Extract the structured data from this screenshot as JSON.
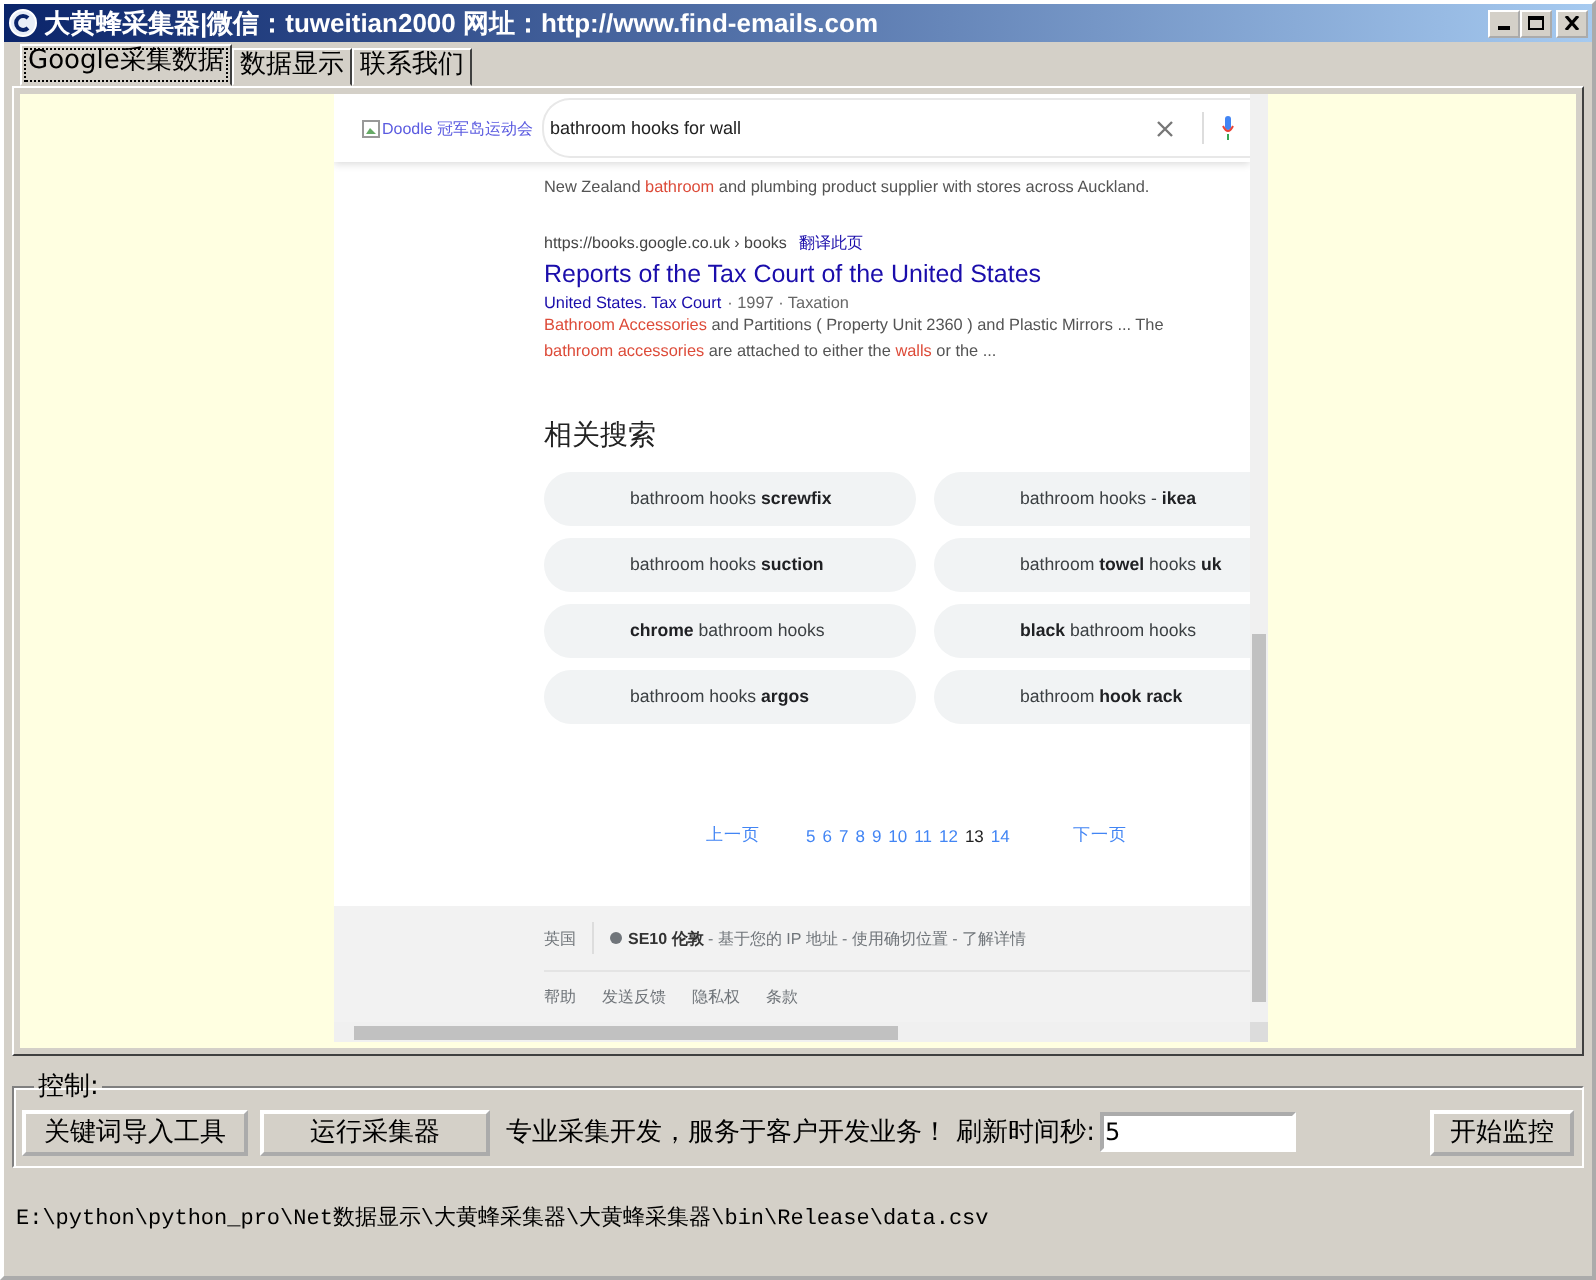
{
  "window": {
    "title": "大黄蜂采集器|微信：tuweitian2000 网址：http://www.find-emails.com"
  },
  "tabs": [
    {
      "label": "Google采集数据",
      "selected": true
    },
    {
      "label": "数据显示",
      "selected": false
    },
    {
      "label": "联系我们",
      "selected": false
    }
  ],
  "browser": {
    "doodle": "Doodle 冠军岛运动会",
    "search": {
      "value": "bathroom hooks for wall"
    },
    "results": [
      {
        "snippet": "New Zealand **bathroom** and plumbing product supplier with stores across Auckland."
      },
      {
        "url": "https://books.google.co.uk › books",
        "translate": "翻译此页",
        "title": "Reports of the Tax Court of the United States",
        "author": "United States. Tax Court",
        "meta": "· 1997 · Taxation",
        "snippet": "**Bathroom Accessories** and Partitions ( Property Unit 2360 ) and Plastic Mirrors ... The **bathroom accessories** are attached to either the **walls** or the ..."
      }
    ],
    "related_title": "相关搜索",
    "related": [
      "bathroom hooks **screwfix**",
      "bathroom hooks - **ikea**",
      "bathroom hooks **suction**",
      "bathroom **towel** hooks **uk**",
      "**chrome** bathroom hooks",
      "**black** bathroom hooks",
      "bathroom hooks **argos**",
      "bathroom **hook rack**"
    ],
    "pagination": {
      "previous": "上一页",
      "next": "下一页",
      "pages": [
        {
          "label": "5",
          "selected": false
        },
        {
          "label": "6",
          "selected": false
        },
        {
          "label": "7",
          "selected": false
        },
        {
          "label": "8",
          "selected": false
        },
        {
          "label": "9",
          "selected": false
        },
        {
          "label": "10",
          "selected": false
        },
        {
          "label": "11",
          "selected": false
        },
        {
          "label": "12",
          "selected": false
        },
        {
          "label": "13",
          "selected": true
        },
        {
          "label": "14",
          "selected": false
        }
      ]
    },
    "footer": {
      "country": "英国",
      "location": "**SE10 伦敦** - 基于您的 IP 地址 - 使用确切位置 - 了解详情",
      "links": [
        "帮助",
        "发送反馈",
        "隐私权",
        "条款"
      ]
    }
  },
  "control": {
    "legend": "控制:",
    "buttons": [
      "关键词导入工具",
      "运行采集器"
    ],
    "info": "专业采集开发，服务于客户开发业务！ 刷新时间秒:",
    "refresh": {
      "value": "5"
    },
    "start_button": "开始监控"
  },
  "status_path": "E:\\python\\python_pro\\Net数据显示\\大黄蜂采集器\\大黄蜂采集器\\bin\\Release\\data.csv"
}
